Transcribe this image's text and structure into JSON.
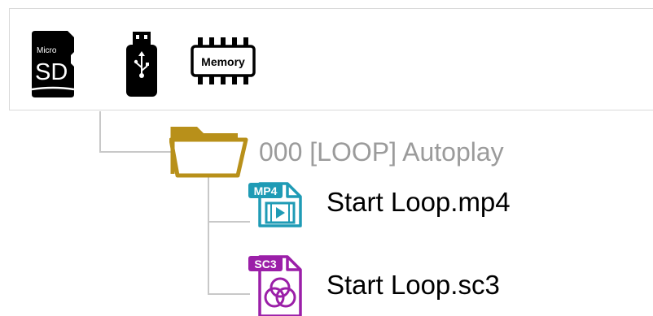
{
  "storage": {
    "devices": [
      {
        "icon": "micro-sd-card-icon",
        "top_text": "Micro",
        "main_text": "SD"
      },
      {
        "icon": "usb-drive-icon"
      },
      {
        "icon": "memory-chip-icon",
        "text": "Memory"
      }
    ]
  },
  "tree": {
    "folder": {
      "label": "000 [LOOP] Autoplay",
      "icon": "folder-icon",
      "color": "#b8901a"
    },
    "files": [
      {
        "label": "Start Loop.mp4",
        "badge": "MP4",
        "icon": "video-file-icon",
        "color": "#1f9bb5"
      },
      {
        "label": "Start Loop.sc3",
        "badge": "SC3",
        "icon": "color-file-icon",
        "color": "#9b1fa8"
      }
    ]
  }
}
